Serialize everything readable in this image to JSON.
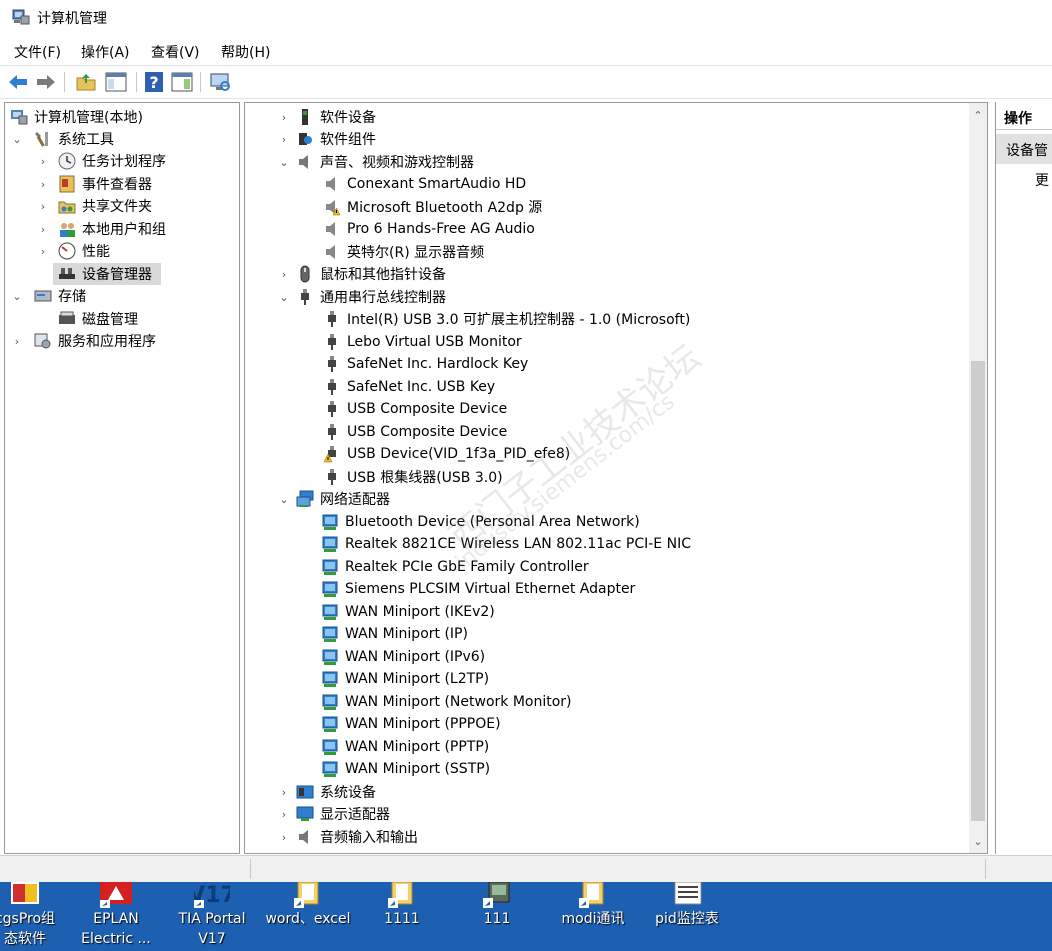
{
  "window": {
    "title": "计算机管理"
  },
  "menu": {
    "file": "文件(F)",
    "action": "操作(A)",
    "view": "查看(V)",
    "help": "帮助(H)"
  },
  "left_tree": {
    "root": "计算机管理(本地)",
    "system_tools": "系统工具",
    "task_scheduler": "任务计划程序",
    "event_viewer": "事件查看器",
    "shared_folders": "共享文件夹",
    "local_users": "本地用户和组",
    "performance": "性能",
    "device_manager": "设备管理器",
    "storage": "存储",
    "disk_management": "磁盘管理",
    "services_apps": "服务和应用程序"
  },
  "devices": {
    "software_devices": "软件设备",
    "software_components": "软件组件",
    "sound": {
      "label": "声音、视频和游戏控制器",
      "items": [
        "Conexant SmartAudio HD",
        "Microsoft Bluetooth A2dp 源",
        "Pro 6 Hands-Free AG Audio",
        "英特尔(R) 显示器音频"
      ]
    },
    "mice": "鼠标和其他指针设备",
    "usb": {
      "label": "通用串行总线控制器",
      "items": [
        "Intel(R) USB 3.0 可扩展主机控制器 - 1.0 (Microsoft)",
        "Lebo Virtual USB Monitor",
        "SafeNet Inc. Hardlock Key",
        "SafeNet Inc. USB Key",
        "USB Composite Device",
        "USB Composite Device",
        "USB Device(VID_1f3a_PID_efe8)",
        "USB 根集线器(USB 3.0)"
      ]
    },
    "network": {
      "label": "网络适配器",
      "items": [
        "Bluetooth Device (Personal Area Network)",
        "Realtek 8821CE Wireless LAN 802.11ac PCI-E NIC",
        "Realtek PCIe GbE Family Controller",
        "Siemens PLCSIM Virtual Ethernet Adapter",
        "WAN Miniport (IKEv2)",
        "WAN Miniport (IP)",
        "WAN Miniport (IPv6)",
        "WAN Miniport (L2TP)",
        "WAN Miniport (Network Monitor)",
        "WAN Miniport (PPPOE)",
        "WAN Miniport (PPTP)",
        "WAN Miniport (SSTP)"
      ]
    },
    "system_devices": "系统设备",
    "display_adapters": "显示适配器",
    "audio_io": "音频输入和输出"
  },
  "actions": {
    "header": "操作",
    "section": "设备管",
    "more": "更"
  },
  "watermark": {
    "line1": "西门子工业技术论坛",
    "line2": "industry.siemens.com/cs"
  },
  "desktop": {
    "icons": [
      {
        "line1": "cgsPro组",
        "line2": "态软件"
      },
      {
        "line1": "EPLAN",
        "line2": "Electric ..."
      },
      {
        "line1": "TIA Portal",
        "line2": "V17"
      },
      {
        "line1": "word、excel",
        "line2": ""
      },
      {
        "line1": "1111",
        "line2": ""
      },
      {
        "line1": "111",
        "line2": ""
      },
      {
        "line1": "modi通讯",
        "line2": ""
      },
      {
        "line1": "pid监控表",
        "line2": ""
      }
    ]
  },
  "colors": {
    "network_icon": "#2f7fd0",
    "warning": "#f2b51c",
    "desktop": "#1d5fb0"
  }
}
